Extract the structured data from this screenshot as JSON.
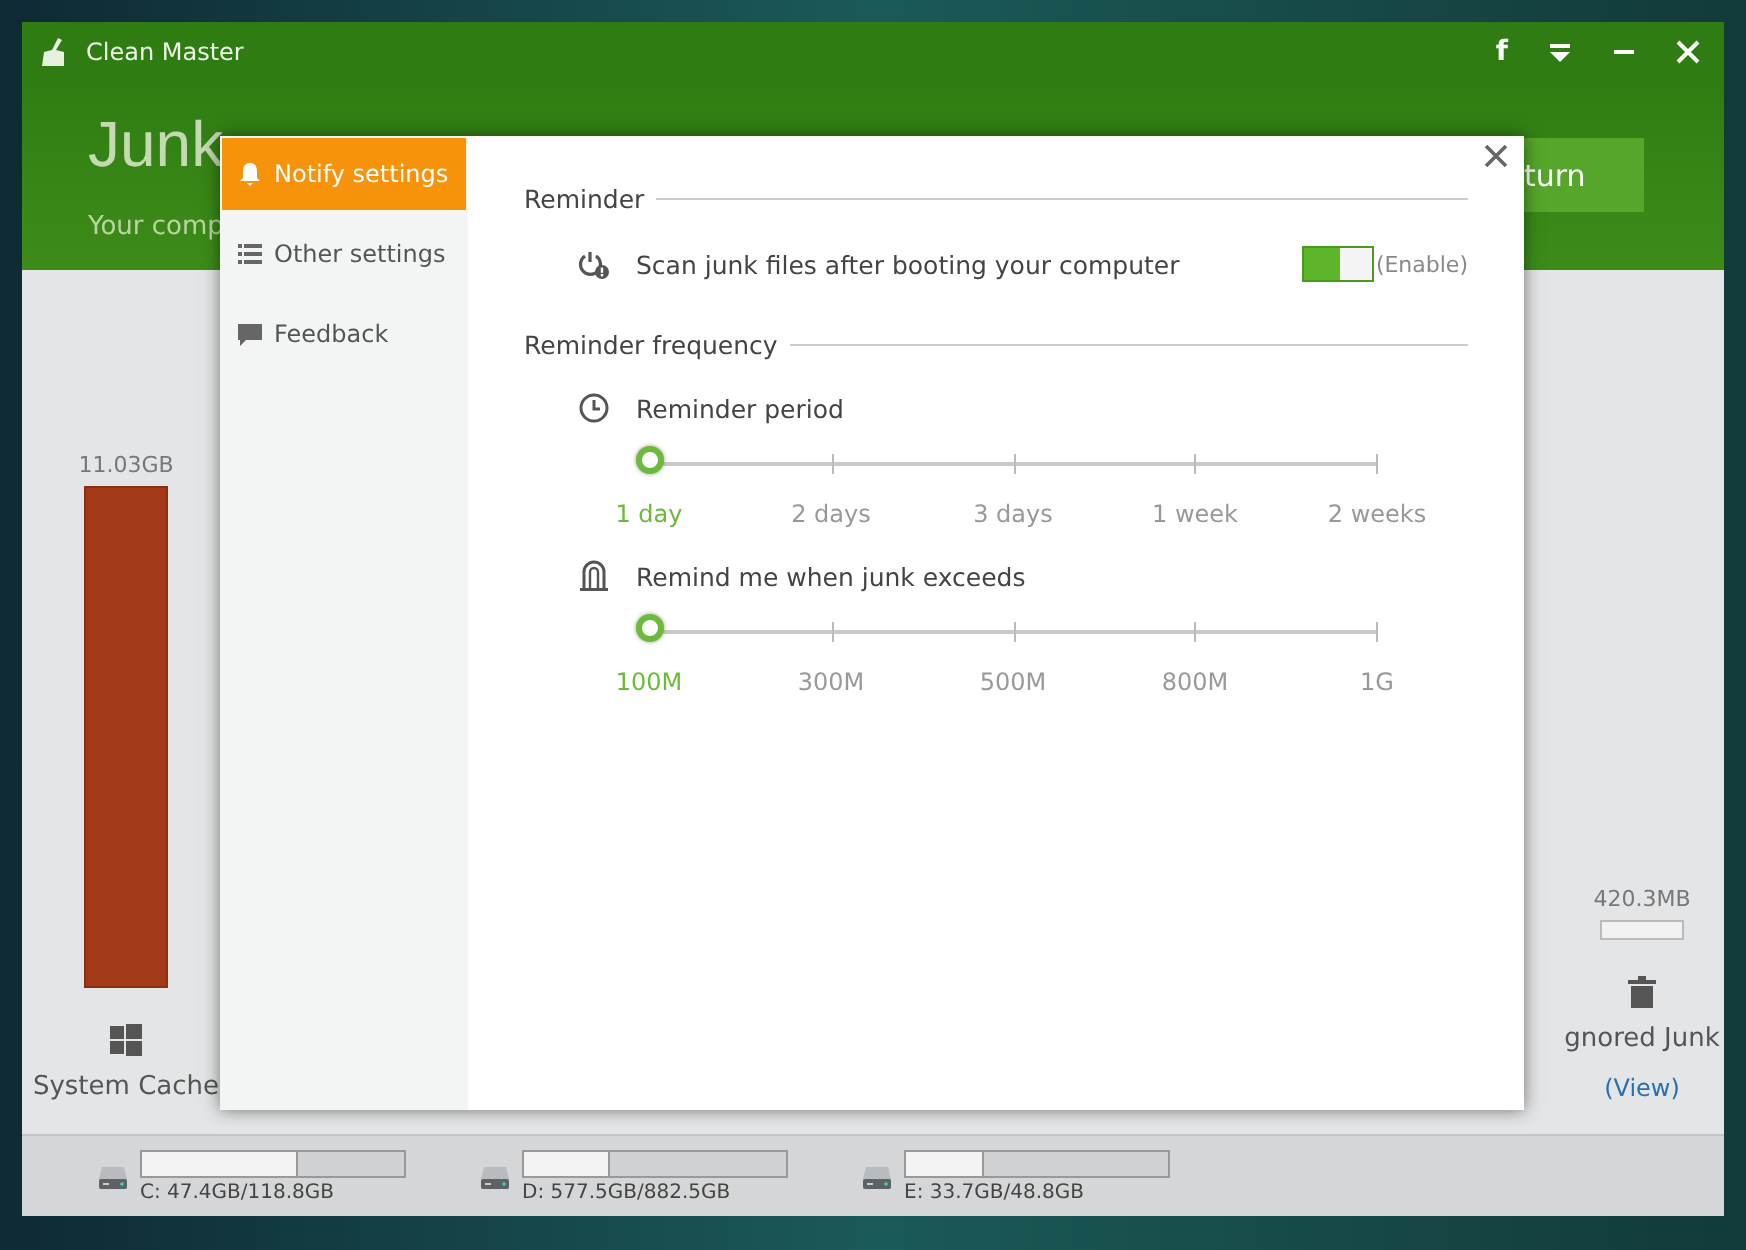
{
  "app": {
    "title": "Clean Master",
    "social_button": "f"
  },
  "header": {
    "headline": "Junk",
    "subtitle": "Your comp",
    "action_button": "turn"
  },
  "columns": [
    {
      "size": "11.03GB",
      "level": 1,
      "label": "System Cache",
      "kind": "windows"
    },
    {
      "size": "420.3MB",
      "label": "gnored Junk",
      "kind": "trash",
      "link": "(View)"
    }
  ],
  "drives": [
    {
      "label": "C: 47.4GB/118.8GB",
      "level": 0.59
    },
    {
      "label": "D: 577.5GB/882.5GB",
      "level": 0.32
    },
    {
      "label": "E: 33.7GB/48.8GB",
      "level": 0.29
    }
  ],
  "dialog": {
    "tabs": [
      {
        "label": "Notify settings",
        "selected": true,
        "kind": "bell"
      },
      {
        "label": "Other settings",
        "selected": false,
        "kind": "list"
      },
      {
        "label": "Feedback",
        "selected": false,
        "kind": "chat"
      }
    ],
    "reminder": {
      "heading": "Reminder",
      "option": "Scan junk files after booting your computer",
      "on": true,
      "toggle_label": "(Enable)"
    },
    "frequency": {
      "heading": "Reminder frequency",
      "sliders": [
        {
          "label": "Reminder period",
          "kind": "clock",
          "level": 0,
          "options": [
            {
              "label": "1 day",
              "selected": true
            },
            {
              "label": "2 days",
              "selected": false
            },
            {
              "label": "3 days",
              "selected": false
            },
            {
              "label": "1 week",
              "selected": false
            },
            {
              "label": "2 weeks",
              "selected": false
            }
          ]
        },
        {
          "label": "Remind me when junk exceeds",
          "kind": "bin",
          "level": 0,
          "options": [
            {
              "label": "100M",
              "selected": true
            },
            {
              "label": "300M",
              "selected": false
            },
            {
              "label": "500M",
              "selected": false
            },
            {
              "label": "800M",
              "selected": false
            },
            {
              "label": "1G",
              "selected": false
            }
          ]
        }
      ]
    }
  }
}
